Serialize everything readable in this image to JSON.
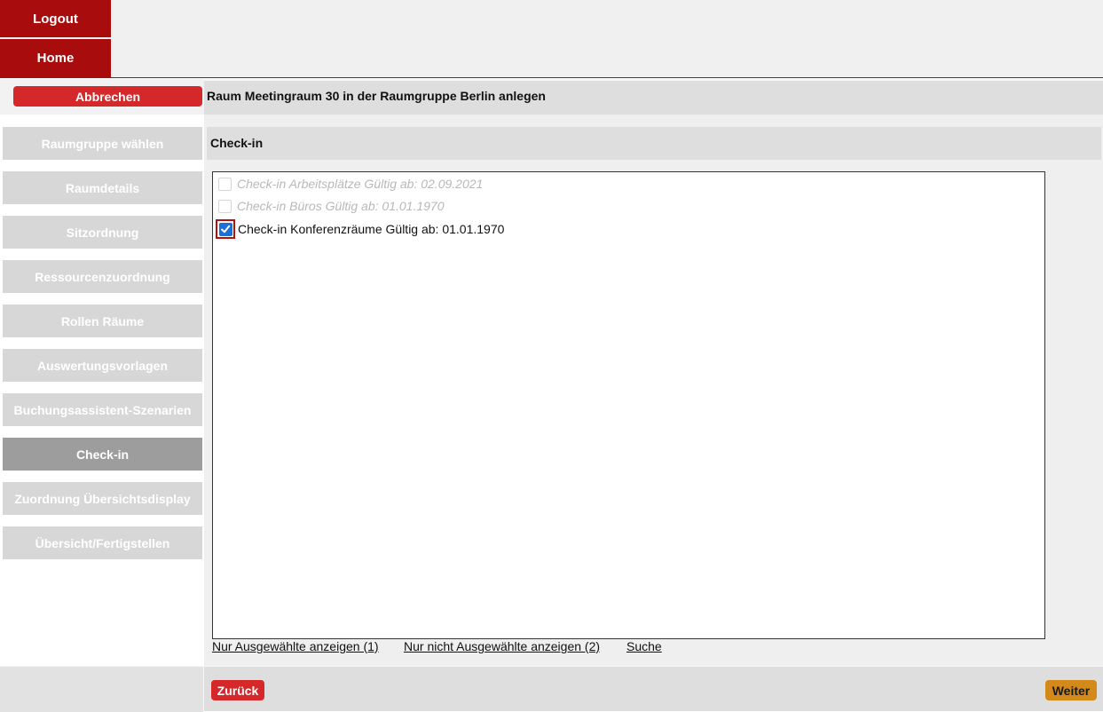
{
  "topnav": {
    "logout_label": "Logout",
    "home_label": "Home"
  },
  "header": {
    "cancel_label": "Abbrechen",
    "title": "Raum Meetingraum 30 in der Raumgruppe Berlin anlegen"
  },
  "sidebar": {
    "items": [
      {
        "label": "Raumgruppe wählen",
        "active": false
      },
      {
        "label": "Raumdetails",
        "active": false
      },
      {
        "label": "Sitzordnung",
        "active": false
      },
      {
        "label": "Ressourcenzuordnung",
        "active": false
      },
      {
        "label": "Rollen Räume",
        "active": false
      },
      {
        "label": "Auswertungsvorlagen",
        "active": false
      },
      {
        "label": "Buchungsassistent-Szenarien",
        "active": false
      },
      {
        "label": "Check-in",
        "active": true
      },
      {
        "label": "Zuordnung Übersichtsdisplay",
        "active": false
      },
      {
        "label": "Übersicht/Fertigstellen",
        "active": false
      }
    ]
  },
  "section": {
    "title": "Check-in"
  },
  "options": [
    {
      "label": "Check-in Arbeitsplätze Gültig ab: 02.09.2021",
      "checked": false,
      "disabled": true
    },
    {
      "label": "Check-in Büros Gültig ab: 01.01.1970",
      "checked": false,
      "disabled": true
    },
    {
      "label": "Check-in Konferenzräume Gültig ab: 01.01.1970",
      "checked": true,
      "disabled": false
    }
  ],
  "links": {
    "selected_only": "Nur Ausgewählte anzeigen (1)",
    "unselected_only": "Nur nicht Ausgewählte anzeigen (2)",
    "search": "Suche"
  },
  "footer": {
    "back_label": "Zurück",
    "next_label": "Weiter"
  },
  "colors": {
    "brand_red": "#a80c0c",
    "button_red": "#d4282a",
    "next_orange": "#d48a1a",
    "checkbox_blue": "#1a6fd8"
  }
}
